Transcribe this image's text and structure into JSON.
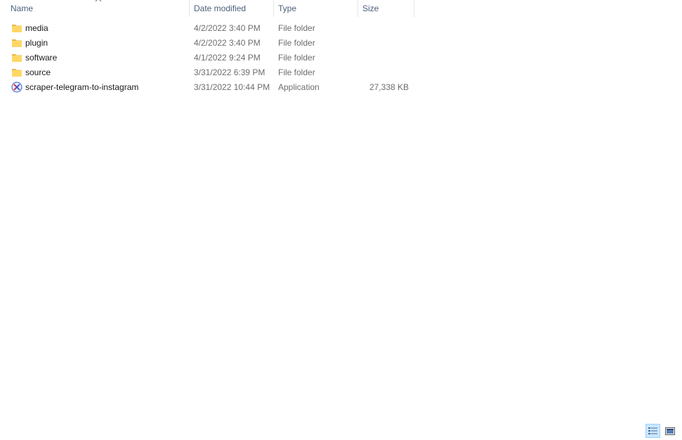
{
  "columns": {
    "name": "Name",
    "date_modified": "Date modified",
    "type": "Type",
    "size": "Size"
  },
  "sort": {
    "column": "Name",
    "icon": "sort-up-arrow-icon"
  },
  "files": [
    {
      "name": "media",
      "date_modified": "4/2/2022 3:40 PM",
      "type": "File folder",
      "size": "",
      "icon": "folder-icon"
    },
    {
      "name": "plugin",
      "date_modified": "4/2/2022 3:40 PM",
      "type": "File folder",
      "size": "",
      "icon": "folder-icon"
    },
    {
      "name": "software",
      "date_modified": "4/1/2022 9:24 PM",
      "type": "File folder",
      "size": "",
      "icon": "folder-icon"
    },
    {
      "name": "source",
      "date_modified": "3/31/2022 6:39 PM",
      "type": "File folder",
      "size": "",
      "icon": "folder-icon"
    },
    {
      "name": "scraper-telegram-to-instagram",
      "date_modified": "3/31/2022 10:44 PM",
      "type": "Application",
      "size": "27,338 KB",
      "icon": "application-icon"
    }
  ],
  "view_buttons": {
    "details": {
      "icon": "details-view-icon",
      "active": true
    },
    "tiles": {
      "icon": "large-icons-view-icon",
      "active": false
    }
  },
  "colors": {
    "header_text": "#4c607a",
    "folder": "#ffd766",
    "selected_view_bg": "#cce8ff",
    "selected_view_border": "#99d1ff"
  }
}
